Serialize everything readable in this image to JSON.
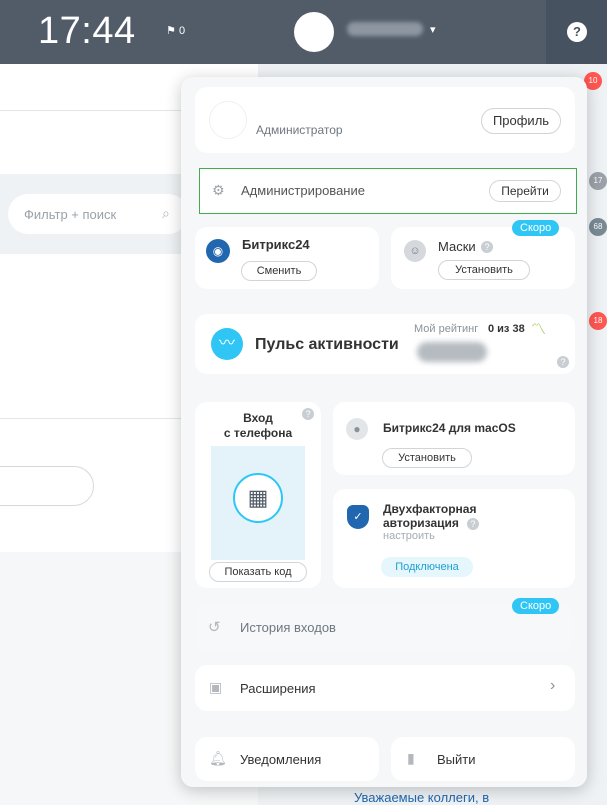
{
  "topbar": {
    "time": "17:44",
    "flag_count": "0",
    "caret": "▾",
    "help_label": "?"
  },
  "background": {
    "filter_placeholder": "Фильтр + поиск",
    "badges": [
      "10",
      "17",
      "68",
      "18"
    ],
    "bottom_text": "Уважаемые коллеги, в"
  },
  "popup": {
    "role": "Администратор",
    "profile_button": "Профиль",
    "admin": {
      "label": "Администрирование",
      "button": "Перейти"
    },
    "bitrix24": {
      "title": "Битрикс24",
      "button": "Сменить"
    },
    "masks": {
      "title": "Маски",
      "button": "Установить",
      "badge": "Скоро"
    },
    "pulse": {
      "title": "Пульс активности",
      "rating_label": "Мой рейтинг",
      "rating_value": "0 из 38"
    },
    "phone_login": {
      "title_line1": "Вход",
      "title_line2": "с телефона",
      "button": "Показать код"
    },
    "macos": {
      "title": "Битрикс24 для macOS",
      "button": "Установить"
    },
    "twofa": {
      "title_line1": "Двухфакторная",
      "title_line2": "авторизация",
      "sub": "настроить",
      "status": "Подключена"
    },
    "login_history": {
      "label": "История входов",
      "badge": "Скоро"
    },
    "extensions": {
      "label": "Расширения"
    },
    "notifications": {
      "label": "Уведомления"
    },
    "logout": {
      "label": "Выйти"
    }
  },
  "colors": {
    "topbar": "#525c69",
    "accent_blue": "#2fc6f6",
    "highlight_green": "#3fae4f",
    "link_blue": "#2067b0"
  }
}
